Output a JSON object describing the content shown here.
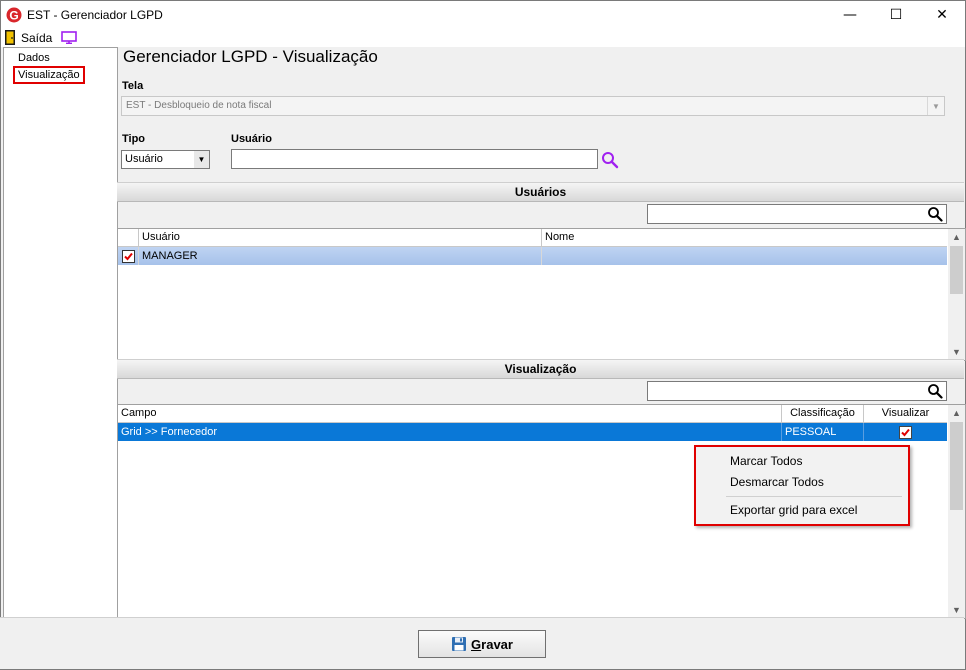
{
  "window": {
    "title": "EST - Gerenciador LGPD",
    "min_glyph": "—",
    "max_glyph": "☐",
    "close_glyph": "✕"
  },
  "menubar": {
    "saida_label": "Saída"
  },
  "tree": {
    "items": [
      "Dados",
      "Visualização"
    ],
    "selected": "Visualização"
  },
  "header": {
    "page_title": "Gerenciador LGPD - Visualização"
  },
  "form": {
    "tela_label": "Tela",
    "tela_value": "EST - Desbloqueio de nota fiscal",
    "tipo_label": "Tipo",
    "tipo_value": "Usuário",
    "usuario_label": "Usuário",
    "usuario_value": ""
  },
  "usuarios_section": {
    "title": "Usuários",
    "columns": [
      "Usuário",
      "Nome"
    ],
    "rows": [
      {
        "checked": true,
        "usuario": "MANAGER",
        "nome": ""
      }
    ]
  },
  "visualizacao_section": {
    "title": "Visualização",
    "columns": [
      "Campo",
      "Classificação",
      "Visualizar"
    ],
    "rows": [
      {
        "campo": "Grid >> Fornecedor",
        "classificacao": "PESSOAL",
        "visualizar": true
      }
    ]
  },
  "context_menu": {
    "items": [
      "Marcar Todos",
      "Desmarcar Todos",
      "Exportar grid para excel"
    ]
  },
  "footer": {
    "gravar_first": "G",
    "gravar_rest": "ravar"
  },
  "colors": {
    "selection_blue": "#0a78d7",
    "highlight_red": "#e00000",
    "accent_purple": "#a020f0"
  }
}
